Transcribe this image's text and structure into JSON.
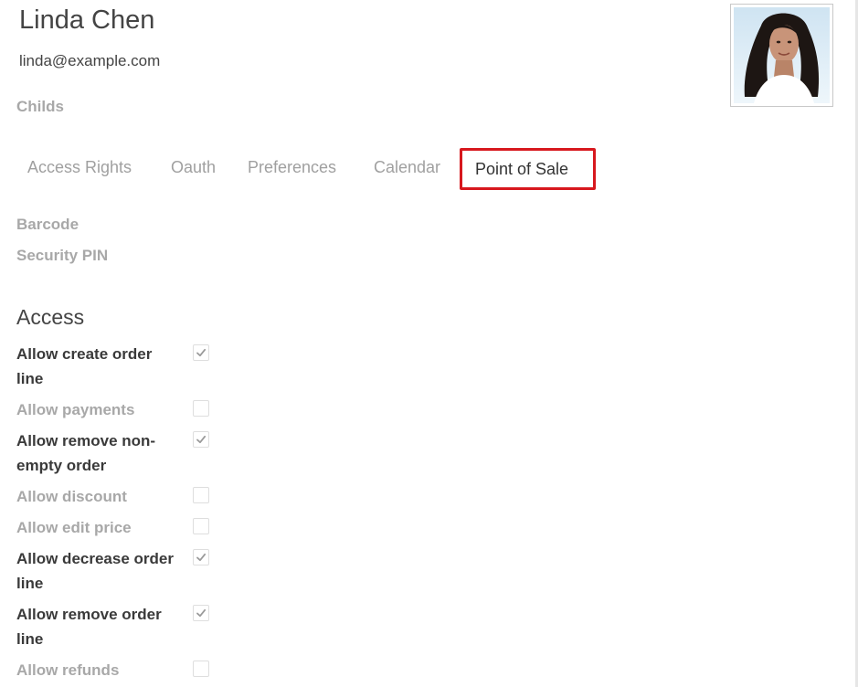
{
  "user": {
    "name": "Linda Chen",
    "email": "linda@example.com",
    "childs_label": "Childs"
  },
  "tabs": [
    {
      "label": "Access Rights",
      "active": false
    },
    {
      "label": "Oauth",
      "active": false
    },
    {
      "label": "Preferences",
      "active": false
    },
    {
      "label": "Calendar",
      "active": false
    },
    {
      "label": "Point of Sale",
      "active": true
    }
  ],
  "fields": {
    "barcode_label": "Barcode",
    "security_pin_label": "Security PIN"
  },
  "access": {
    "title": "Access",
    "permissions": [
      {
        "label": "Allow create order line",
        "checked": true
      },
      {
        "label": "Allow payments",
        "checked": false
      },
      {
        "label": "Allow remove non-empty order",
        "checked": true
      },
      {
        "label": "Allow discount",
        "checked": false
      },
      {
        "label": "Allow edit price",
        "checked": false
      },
      {
        "label": "Allow decrease order line",
        "checked": true
      },
      {
        "label": "Allow remove order line",
        "checked": true
      },
      {
        "label": "Allow refunds",
        "checked": false
      }
    ]
  },
  "colors": {
    "active_tab_border": "#d7181e",
    "checkmark": "#9a9a9a",
    "muted_text": "#a8a8a8"
  }
}
